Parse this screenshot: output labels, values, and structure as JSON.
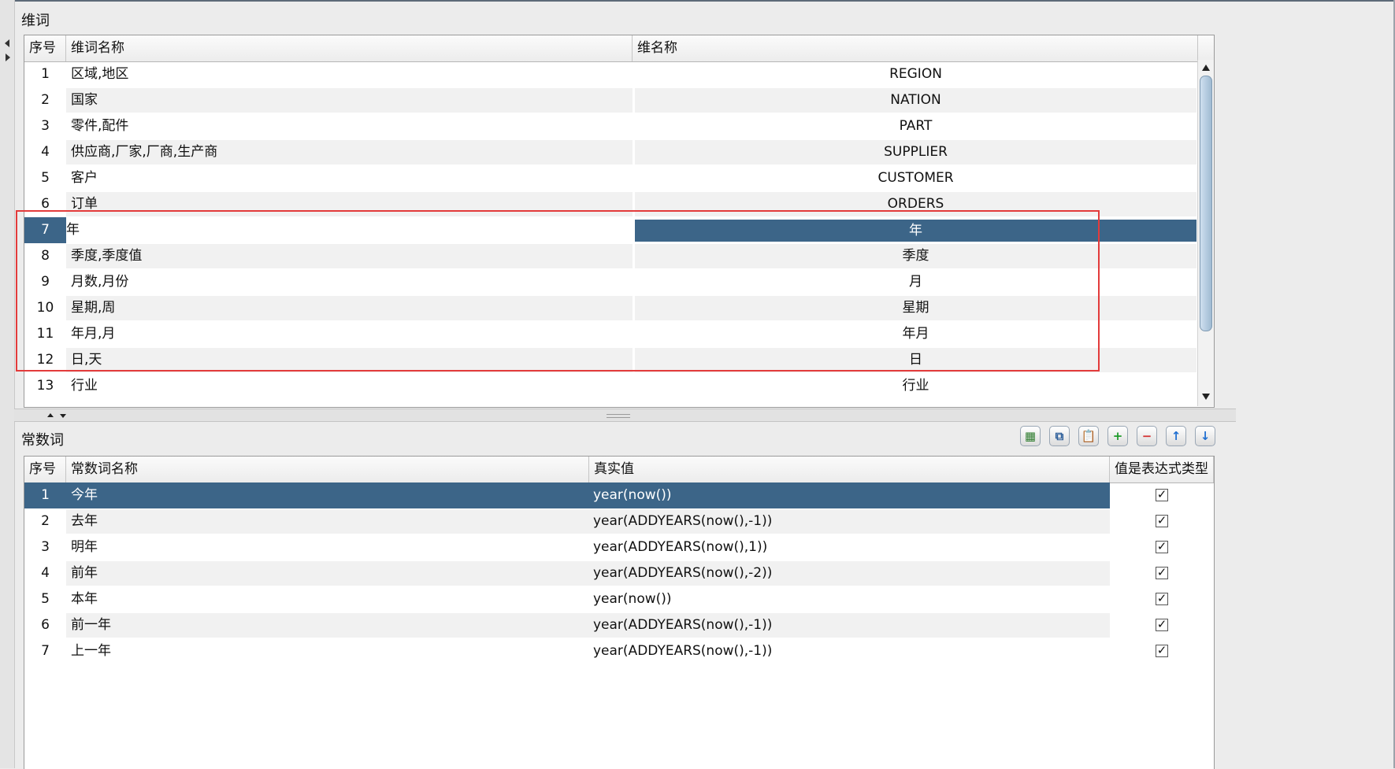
{
  "dimension_section": {
    "title": "维词",
    "columns": [
      "序号",
      "维词名称",
      "维名称"
    ],
    "rows": [
      {
        "no": "1",
        "name": "区域,地区",
        "dim": "REGION"
      },
      {
        "no": "2",
        "name": "国家",
        "dim": "NATION"
      },
      {
        "no": "3",
        "name": "零件,配件",
        "dim": "PART"
      },
      {
        "no": "4",
        "name": "供应商,厂家,厂商,生产商",
        "dim": "SUPPLIER"
      },
      {
        "no": "5",
        "name": "客户",
        "dim": "CUSTOMER"
      },
      {
        "no": "6",
        "name": "订单",
        "dim": "ORDERS"
      },
      {
        "no": "7",
        "name": "年",
        "dim": "年"
      },
      {
        "no": "8",
        "name": "季度,季度值",
        "dim": "季度"
      },
      {
        "no": "9",
        "name": "月数,月份",
        "dim": "月"
      },
      {
        "no": "10",
        "name": "星期,周",
        "dim": "星期"
      },
      {
        "no": "11",
        "name": "年月,月",
        "dim": "年月"
      },
      {
        "no": "12",
        "name": "日,天",
        "dim": "日"
      },
      {
        "no": "13",
        "name": "行业",
        "dim": "行业"
      }
    ]
  },
  "constant_section": {
    "title": "常数词",
    "columns": [
      "序号",
      "常数词名称",
      "真实值",
      "值是表达式类型"
    ],
    "rows": [
      {
        "no": "1",
        "name": "今年",
        "value": "year(now())",
        "is_expr": true
      },
      {
        "no": "2",
        "name": "去年",
        "value": "year(ADDYEARS(now(),-1))",
        "is_expr": true
      },
      {
        "no": "3",
        "name": "明年",
        "value": "year(ADDYEARS(now(),1))",
        "is_expr": true
      },
      {
        "no": "4",
        "name": "前年",
        "value": "year(ADDYEARS(now(),-2))",
        "is_expr": true
      },
      {
        "no": "5",
        "name": "本年",
        "value": "year(now())",
        "is_expr": true
      },
      {
        "no": "6",
        "name": "前一年",
        "value": "year(ADDYEARS(now(),-1))",
        "is_expr": true
      },
      {
        "no": "7",
        "name": "上一年",
        "value": "year(ADDYEARS(now(),-1))",
        "is_expr": true
      }
    ],
    "toolbar": [
      {
        "name": "insert-row-button",
        "icon": "table-add-icon",
        "glyph": "▦",
        "color": "#2f7d2f"
      },
      {
        "name": "copy-button",
        "icon": "copy-icon",
        "glyph": "⧉",
        "color": "#2b5d99"
      },
      {
        "name": "paste-button",
        "icon": "paste-icon",
        "glyph": "📋",
        "color": "#b7791f"
      },
      {
        "name": "add-button",
        "icon": "plus-icon",
        "glyph": "+",
        "color": "#1e9b2a"
      },
      {
        "name": "delete-button",
        "icon": "minus-icon",
        "glyph": "−",
        "color": "#d32f2f"
      },
      {
        "name": "move-up-button",
        "icon": "arrow-up-icon",
        "glyph": "↑",
        "color": "#1f6fd1"
      },
      {
        "name": "move-down-button",
        "icon": "arrow-down-icon",
        "glyph": "↓",
        "color": "#1f6fd1"
      }
    ]
  },
  "check_glyph": "✓",
  "colors": {
    "selection": "#3c6588",
    "highlight_box": "#e33b3b"
  },
  "selected": {
    "dimension_row": 7,
    "constant_row": 1
  }
}
